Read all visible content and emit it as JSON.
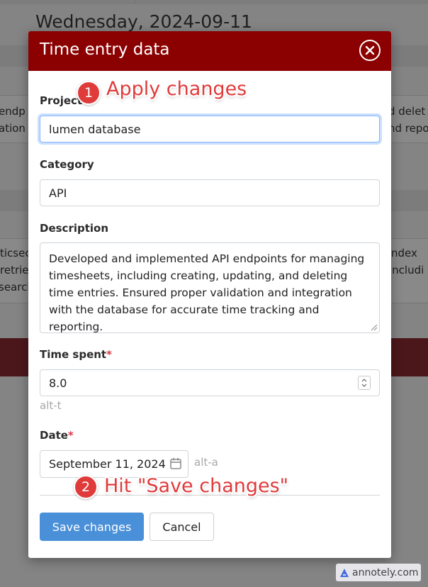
{
  "background": {
    "heading": "Wednesday, 2024-09-11",
    "card1": {
      "left_lines": [
        "endp",
        "ation"
      ],
      "right_lines": [
        "d delet",
        "nd repo"
      ]
    },
    "card2": {
      "left_lines": [
        "ticsec",
        "retrie",
        "search"
      ],
      "right_lines": [
        "ndex",
        "includi"
      ]
    }
  },
  "modal": {
    "title": "Time entry data",
    "close_icon": "close-circle-icon",
    "fields": {
      "project": {
        "label": "Project",
        "value": "lumen database"
      },
      "category": {
        "label": "Category",
        "value": "API"
      },
      "description": {
        "label": "Description",
        "value": "Developed and implemented API endpoints for managing timesheets, including creating, updating, and deleting time entries. Ensured proper validation and integration with the database for accurate time tracking and reporting."
      },
      "time_spent": {
        "label": "Time spent",
        "required_mark": "*",
        "value": "8.0",
        "hint": "alt-t"
      },
      "date": {
        "label": "Date",
        "required_mark": "*",
        "value": "September 11, 2024",
        "hint": "alt-a"
      }
    },
    "buttons": {
      "save": "Save changes",
      "cancel": "Cancel"
    }
  },
  "annotations": [
    {
      "number": "1",
      "text": "Apply changes"
    },
    {
      "number": "2",
      "text": "Hit \"Save changes\""
    }
  ],
  "watermark": "annotely.com",
  "colors": {
    "header_bg": "#8b0000",
    "primary_button": "#4a90d9",
    "required": "#dc3545",
    "annotation": "#e03b3b"
  }
}
